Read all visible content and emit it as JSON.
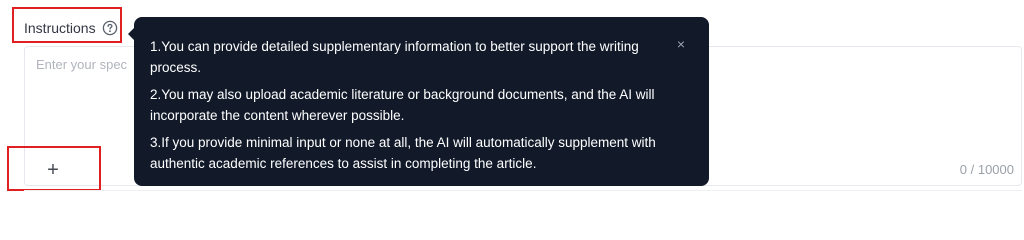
{
  "field": {
    "label": "Instructions",
    "placeholder": "Enter your spec",
    "counter": "0 / 10000",
    "add_label": "+"
  },
  "tooltip": {
    "items": [
      "1.You can provide detailed supplementary information to better support the writing process.",
      "2.You may also upload academic literature or background documents, and the AI will incorporate the content wherever possible.",
      "3.If you provide minimal input or none at all, the AI will automatically supplement with authentic academic references to assist in completing the article."
    ],
    "close_glyph": "×"
  },
  "colors": {
    "tooltip_bg": "#121a2a",
    "highlight_border": "#e02020"
  },
  "icons": {
    "help": "question-circle-icon",
    "close": "close-icon",
    "add": "plus-icon"
  }
}
